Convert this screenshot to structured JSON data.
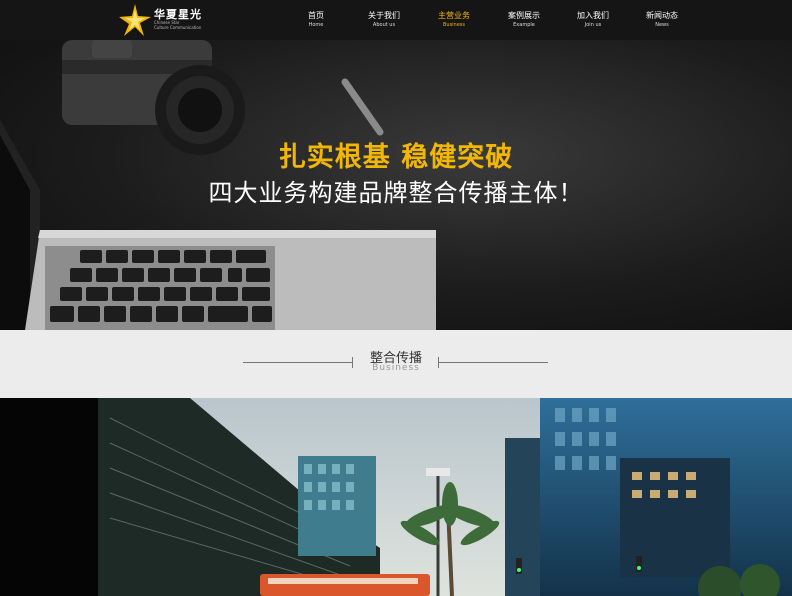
{
  "brand": {
    "name_cn": "华夏星光",
    "name_en": "Chinese Star\nCulture Communication",
    "logo_icon": "star-logo-icon",
    "accent_color": "#f2b705"
  },
  "nav": {
    "items": [
      {
        "cn": "首页",
        "en": "Home"
      },
      {
        "cn": "关于我们",
        "en": "About us"
      },
      {
        "cn": "主营业务",
        "en": "Business"
      },
      {
        "cn": "案例展示",
        "en": "Example"
      },
      {
        "cn": "加入我们",
        "en": "Join us"
      },
      {
        "cn": "新闻动态",
        "en": "News"
      }
    ],
    "active": "主营业务"
  },
  "hero": {
    "title": "扎实根基 稳健突破",
    "subtitle": "四大业务构建品牌整合传播主体！"
  },
  "section": {
    "title_cn": "整合传播",
    "title_en": "Business"
  }
}
